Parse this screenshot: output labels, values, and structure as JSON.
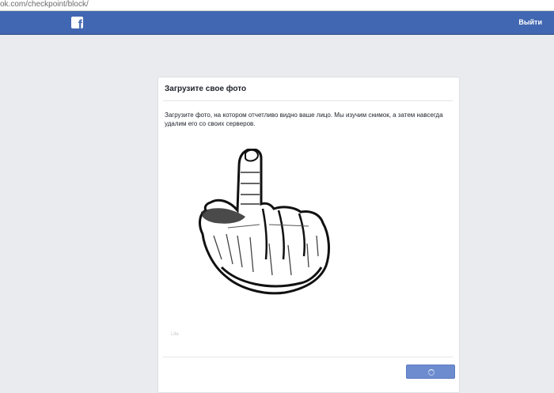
{
  "browser": {
    "url": "ok.com/checkpoint/block/"
  },
  "header": {
    "logo_letter": "f",
    "logout_label": "Выйти"
  },
  "card": {
    "title": "Загрузите свое фото",
    "description": "Загрузите фото, на котором отчетливо видно ваше лицо. Мы изучим снимок, а затем навсегда удалим его со своих серверов.",
    "photo_caption": "Lite"
  },
  "colors": {
    "header": "#4267b2",
    "background": "#e9ebee",
    "button": "#6d8ccf"
  }
}
